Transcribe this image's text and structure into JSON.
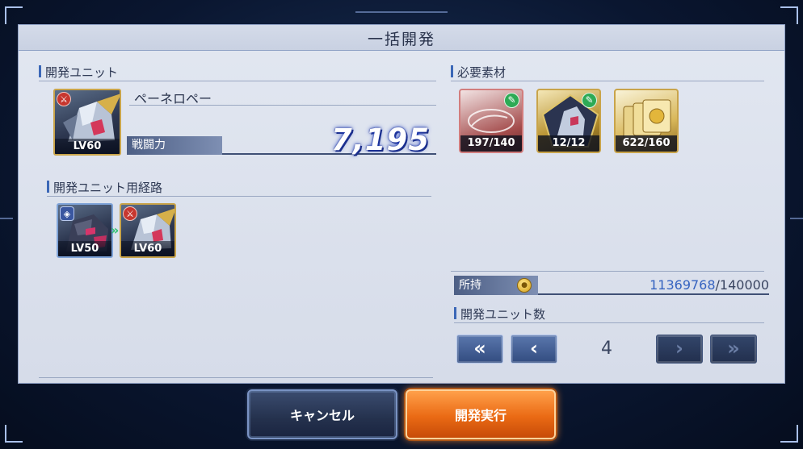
{
  "title": "一括開発",
  "dev_unit": {
    "section_title": "開発ユニット",
    "name": "ペーネロペー",
    "level": "LV60",
    "power_label": "戦闘力",
    "power_value": "7,195"
  },
  "route": {
    "section_title": "開発ユニット用経路",
    "units": [
      {
        "level": "LV50",
        "badge": "shield-badge-icon"
      },
      {
        "level": "LV60",
        "badge": "attack-badge-icon"
      }
    ]
  },
  "materials": {
    "section_title": "必要素材",
    "items": [
      {
        "count": "197/140",
        "icon": "blueprint-material-icon"
      },
      {
        "count": "12/12",
        "icon": "unit-chip-material-icon"
      },
      {
        "count": "622/160",
        "icon": "gold-plates-material-icon"
      }
    ]
  },
  "owned": {
    "label": "所持",
    "current": "11369768",
    "required": "/140000"
  },
  "dev_count": {
    "section_title": "開発ユニット数",
    "value": "4",
    "first_label": "«",
    "prev_label": "‹",
    "next_label": "›",
    "last_label": "»"
  },
  "buttons": {
    "cancel": "キャンセル",
    "execute": "開発実行"
  },
  "colors": {
    "accent_blue": "#3b67b7",
    "execute_orange": "#ea6a14",
    "frame_gold": "#c9a44a"
  }
}
